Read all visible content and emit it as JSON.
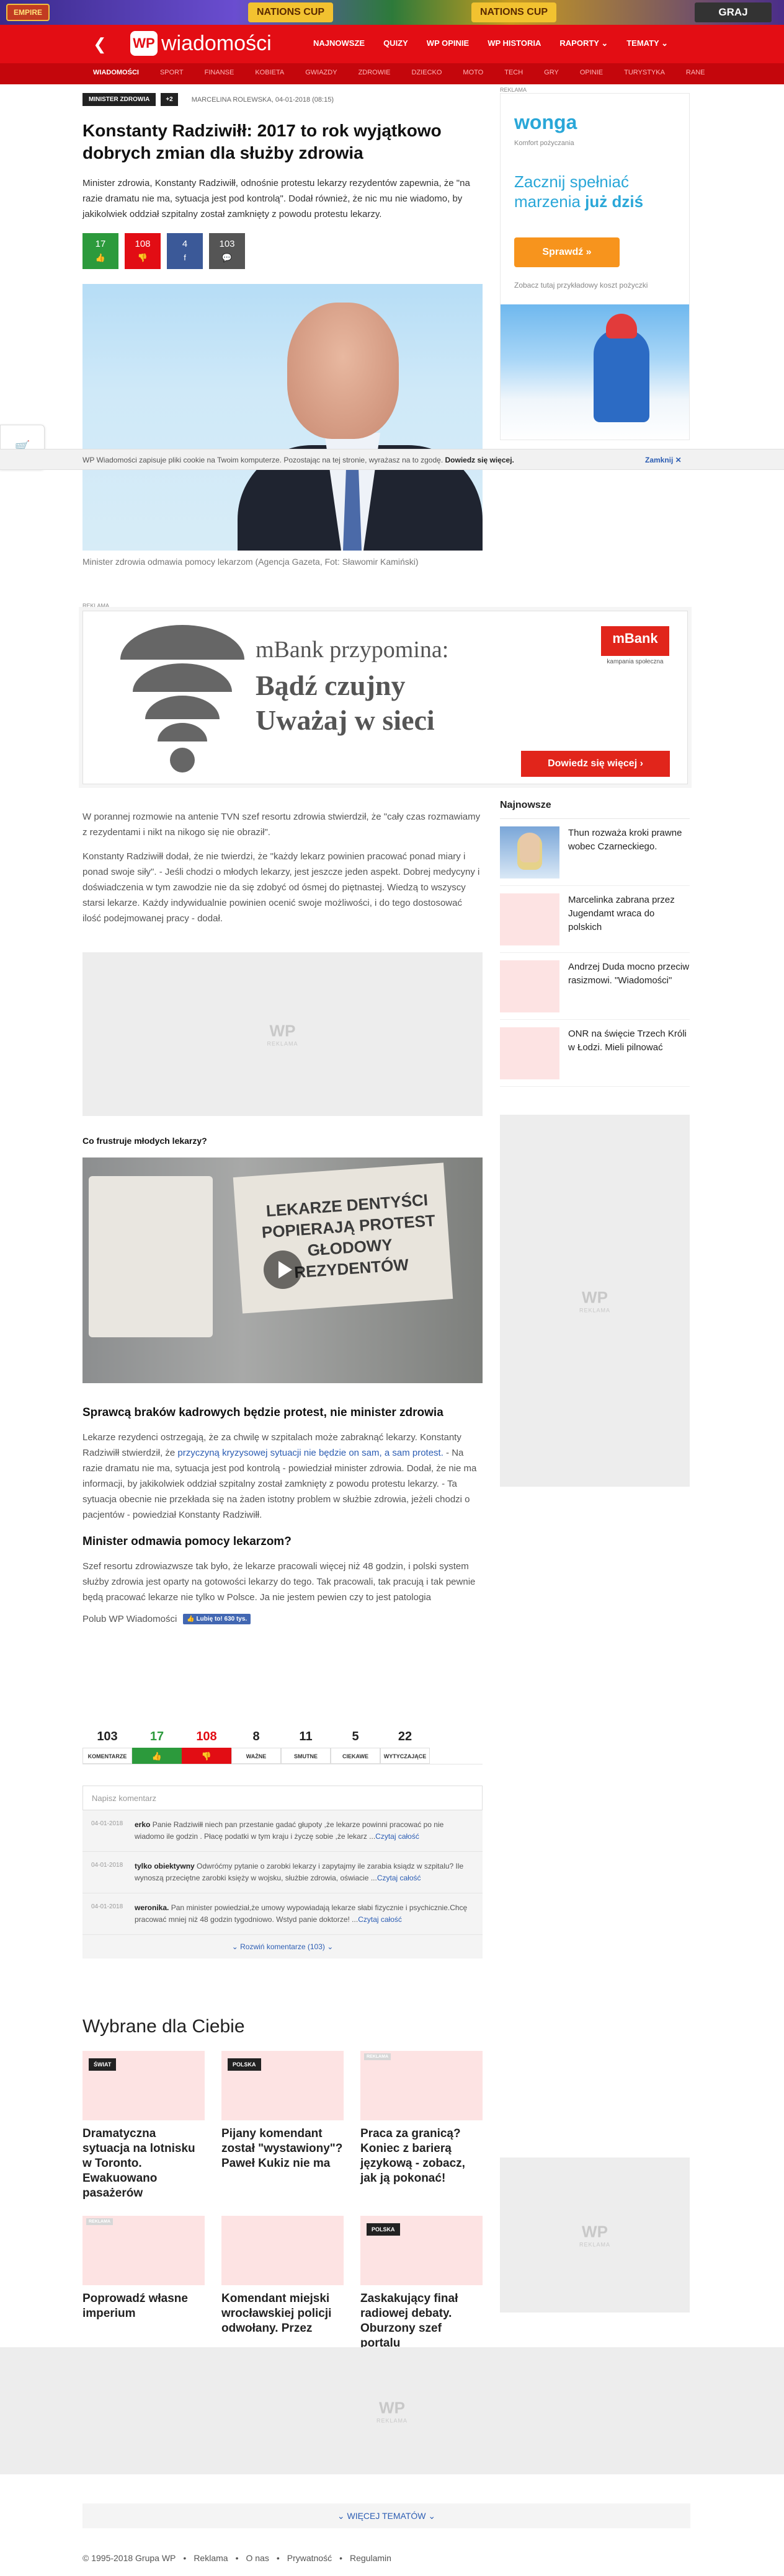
{
  "top_ad": {
    "empire_label": "EMPIRE",
    "promo_1": "NATIONS CUP",
    "promo_2": "NATIONS CUP",
    "play_label": "GRAJ"
  },
  "nav": {
    "logo_mark": "WP",
    "logo_text": "wiadomości",
    "items": [
      "NAJNOWSZE",
      "QUIZY",
      "WP OPINIE",
      "WP HISTORIA",
      "RAPORTY ⌄",
      "TEMATY ⌄"
    ]
  },
  "subnav": {
    "items": [
      "WIADOMOŚCI",
      "SPORT",
      "FINANSE",
      "KOBIETA",
      "GWIAZDY",
      "ZDROWIE",
      "DZIECKO",
      "MOTO",
      "TECH",
      "GRY",
      "OPINIE",
      "TURYSTYKA",
      "RANE"
    ]
  },
  "article": {
    "tag": "MINISTER ZDROWIA",
    "tag_more": "+2",
    "meta": "MARCELINA ROLEWSKA, 04-01-2018 (08:15)",
    "title": "Konstanty Radziwiłł: 2017 to rok wyjątkowo dobrych zmian dla służby zdrowia",
    "lead": "Minister zdrowia, Konstanty Radziwiłł, odnośnie protestu lekarzy rezydentów zapewnia, że \"na razie dramatu nie ma, sytuacja jest pod kontrolą\". Dodał również, że nic mu nie wiadomo, by jakikolwiek oddział szpitalny został zamknięty z powodu protestu lekarzy.",
    "reactions": [
      {
        "value": "17",
        "icon": "👍"
      },
      {
        "value": "108",
        "icon": "👎"
      },
      {
        "value": "4",
        "icon": "f"
      },
      {
        "value": "103",
        "icon": "💬"
      }
    ],
    "caption": "Minister zdrowia odmawia pomocy lekarzom (Agencja Gazeta, Fot: Sławomir Kamiński)"
  },
  "cookie": {
    "text": "WP Wiadomości zapisuje pliki cookie na Twoim komputerze. Pozostając na tej stronie, wyrażasz na to zgodę.",
    "link": "Dowiedz się więcej.",
    "close": "Zamknij ✕"
  },
  "ads": {
    "label": "REKLAMA",
    "wp_mark": "WP",
    "wp_label": "REKLAMA"
  },
  "wonga": {
    "logo": "wonga",
    "sub": "Komfort pożyczania",
    "line1": "Zacznij spełniać marzenia",
    "line1_bold": "już dziś",
    "button": "Sprawdź »",
    "note": "Zobacz tutaj przykładowy koszt pożyczki"
  },
  "mbank": {
    "heading": "mBank przypomina:",
    "line1": "Bądź czujny",
    "line2": "Uważaj w sieci",
    "brand": "mBank",
    "brand_sub": "kampania społeczna",
    "cta": "Dowiedz się więcej ›"
  },
  "najnowsze": {
    "title": "Najnowsze",
    "items": [
      "Thun rozważa kroki prawne wobec Czarneckiego.",
      "Marcelinka zabrana przez Jugendamt wraca do polskich",
      "Andrzej Duda mocno przeciw rasizmowi. \"Wiadomości\"",
      "ONR na święcie Trzech Króli w Łodzi. Mieli pilnować"
    ]
  },
  "body": {
    "p1": "W porannej rozmowie na antenie TVN szef resortu zdrowia stwierdził, że \"cały czas rozmawiamy z rezydentami i nikt na nikogo się nie obraził\".",
    "p2": "Konstanty Radziwiłł dodał, że nie twierdzi, że \"każdy lekarz powinien pracować ponad miary i ponad swoje siły\". - Jeśli chodzi o młodych lekarzy, jest jeszcze jeden aspekt. Dobrej medycyny i doświadczenia w tym zawodzie nie da się zdobyć od ósmej do piętnastej. Wiedzą to wszyscy starsi lekarze. Każdy indywidualnie powinien ocenić swoje możliwości, i do tego dostosować ilość podejmowanej pracy - dodał.",
    "video_heading": "Co frustruje młodych lekarzy?",
    "banner_text": "LEKARZE DENTYŚCI POPIERAJĄ PROTEST GŁODOWY REZYDENTÓW",
    "h3_1": "Sprawcą braków kadrowych będzie protest, nie minister zdrowia",
    "p3a": "Lekarze rezydenci ostrzegają, że za chwilę w szpitalach może zabraknąć lekarzy. Konstanty Radziwiłł stwierdził, że ",
    "p3link": "przyczyną kryzysowej sytuacji nie będzie on sam, a sam protest.",
    "p3b": " - Na razie dramatu nie ma, sytuacja jest pod kontrolą - powiedział minister zdrowia. Dodał, że nie ma informacji, by jakikolwiek oddział szpitalny został zamknięty z powodu protestu lekarzy. - Ta sytuacja obecnie nie przekłada się na żaden istotny problem w służbie zdrowia, jeżeli chodzi o pacjentów - powiedział Konstanty Radziwiłł.",
    "h3_2": "Minister odmawia pomocy lekarzom?",
    "p4": "Szef resortu zdrowiazwsze tak było, że lekarze pracowali więcej niż 48 godzin, i polski system służby zdrowia jest oparty na gotowości lekarzy do tego. Tak pracowali, tak pracują i tak pewnie będą pracować lekarze nie tylko w Polsce. Ja nie jestem pewien czy to jest patologia",
    "like_text": "Polub WP Wiadomości",
    "fb_like": "👍 Lubię to! 630 tys."
  },
  "reactions": [
    {
      "value": "103",
      "label": "KOMENTARZE",
      "kind": ""
    },
    {
      "value": "17",
      "label": "👍",
      "kind": "up"
    },
    {
      "value": "108",
      "label": "👎",
      "kind": "down"
    },
    {
      "value": "8",
      "label": "WAŻNE",
      "kind": ""
    },
    {
      "value": "11",
      "label": "SMUTNE",
      "kind": ""
    },
    {
      "value": "5",
      "label": "CIEKAWE",
      "kind": ""
    },
    {
      "value": "22",
      "label": "WYTYCZAJĄCE",
      "kind": ""
    }
  ],
  "comments": {
    "placeholder": "Napisz komentarz",
    "items": [
      {
        "date": "04-01-2018",
        "author": "erko",
        "text": " Panie Radziwiłł niech pan przestanie gadać głupoty ,że lekarze powinni pracować po nie wiadomo ile godzin . Płacę podatki w tym kraju i życzę sobie ,że lekarz ...",
        "more": "Czytaj całość"
      },
      {
        "date": "04-01-2018",
        "author": "tylko obiektywny",
        "text": " Odwróćmy pytanie o zarobki lekarzy i zapytajmy ile zarabia ksiądz w szpitalu? Ile wynoszą przeciętne zarobki księży w wojsku, służbie zdrowia, oświacie ...",
        "more": "Czytaj całość"
      },
      {
        "date": "04-01-2018",
        "author": "weronika.",
        "text": " Pan minister powiedział,że umowy wypowiadają lekarze słabi fizycznie i psychicznie.Chcę pracować mniej niż 48 godzin tygodniowo. Wstyd panie doktorze! ...",
        "more": "Czytaj całość"
      }
    ],
    "expand": "⌄ Rozwiń komentarze (103) ⌄"
  },
  "wybrane": {
    "title": "Wybrane dla Ciebie",
    "cards": [
      {
        "cat": "ŚWIAT",
        "ad": false,
        "title": "Dramatyczna sytuacja na lotnisku w Toronto. Ewakuowano pasażerów"
      },
      {
        "cat": "POLSKA",
        "ad": false,
        "title": "Pijany komendant został \"wystawiony\"? Paweł Kukiz nie ma"
      },
      {
        "cat": "REKLAMA",
        "ad": true,
        "title": "Praca za granicą? Koniec z barierą językową - zobacz, jak ją pokonać!"
      },
      {
        "cat": "REKLAMA",
        "ad": true,
        "title": "Poprowadź własne imperium"
      },
      {
        "cat": "",
        "ad": false,
        "title": "Komendant miejski wrocławskiej policji odwołany. Przez"
      },
      {
        "cat": "POLSKA",
        "ad": false,
        "title": "Zaskakujący finał radiowej debaty. Oburzony szef portalu"
      }
    ]
  },
  "footer": {
    "more_topics": "⌄ WIĘCEJ TEMATÓW ⌄",
    "links": [
      "© 1995-2018 Grupa WP",
      "•",
      "Reklama",
      "•",
      "O nas",
      "•",
      "Prywatność",
      "•",
      "Regulamin"
    ]
  }
}
